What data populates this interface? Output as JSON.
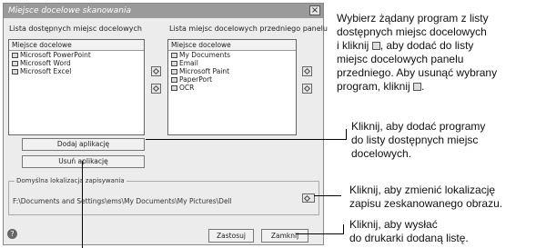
{
  "dialog": {
    "title": "Miejsce docelowe skanowania",
    "close_glyph": "×",
    "left_list_label": "Lista dostępnych miejsc docelowych",
    "right_list_label": "Lista miejsc docelowych przedniego panelu",
    "left_list": {
      "header": "Miejsce docelowe",
      "items": [
        "Microsoft PowerPoint",
        "Microsoft Word",
        "Microsoft Excel"
      ]
    },
    "right_list": {
      "header": "Miejsce docelowe",
      "items": [
        "My Documents",
        "Email",
        "Microsoft Paint",
        "PaperPort",
        "OCR"
      ]
    },
    "add_app_button": "Dodaj aplikację",
    "remove_app_button": "Usuń aplikację",
    "save_location_label": "Domyślna lokalizacja zapisywania",
    "save_location_path": "F:\\Documents and Settings\\ems\\My Documents\\My Pictures\\Dell",
    "help_glyph": "?",
    "apply_button": "Zastosuj",
    "close_button": "Zamknij"
  },
  "notes": {
    "n1_l1": "Wybierz żądany program z listy",
    "n1_l2": "dostępnych miejsc docelowych",
    "n1_l3a": "i kliknij",
    "n1_l3b": ", aby dodać do listy",
    "n1_l4": "miejsc docelowych panelu",
    "n1_l5": "przedniego.  Aby usunąć wybrany",
    "n1_l6a": "program, kliknij",
    "n1_l6b": ".",
    "n2_l1": "Kliknij, aby dodać programy",
    "n2_l2": "do listy dostępnych miejsc",
    "n2_l3": "docelowych.",
    "n3_l1": "Kliknij, aby zmienić lokalizację",
    "n3_l2": "zapisu zeskanowanego obrazu.",
    "n4_l1": "Kliknij, aby wysłać",
    "n4_l2": "do drukarki dodaną listę."
  }
}
